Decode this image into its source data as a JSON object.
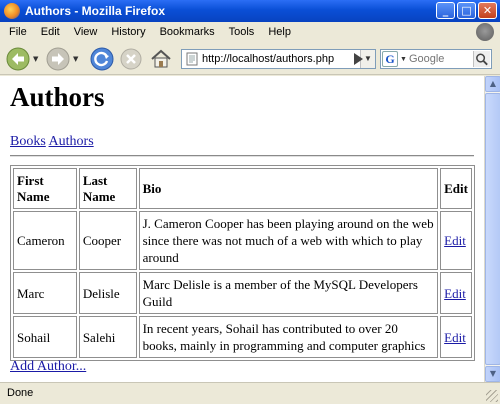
{
  "window": {
    "title": "Authors - Mozilla Firefox",
    "minimize_label": "_",
    "maximize_label": "□",
    "close_label": "✕"
  },
  "menu": [
    "File",
    "Edit",
    "View",
    "History",
    "Bookmarks",
    "Tools",
    "Help"
  ],
  "toolbar": {
    "url": "http://localhost/authors.php",
    "search_placeholder": "Google",
    "search_engine_letter": "G"
  },
  "page": {
    "heading": "Authors",
    "nav_links": [
      "Books",
      "Authors"
    ],
    "table": {
      "headers": [
        "First Name",
        "Last Name",
        "Bio",
        "Edit"
      ],
      "rows": [
        {
          "first": "Cameron",
          "last": "Cooper",
          "bio": "J. Cameron Cooper has been playing around on the web since there was not much of a web with which to play around",
          "edit": "Edit"
        },
        {
          "first": "Marc",
          "last": "Delisle",
          "bio": "Marc Delisle is a member of the MySQL Developers Guild",
          "edit": "Edit"
        },
        {
          "first": "Sohail",
          "last": "Salehi",
          "bio": "In recent years, Sohail has contributed to over 20 books, mainly in programming and computer graphics",
          "edit": "Edit"
        }
      ]
    },
    "add_link": "Add Author..."
  },
  "status": "Done",
  "colors": {
    "titlebar": "#0a4fd6",
    "chrome": "#ece9d8",
    "link": "#1a1aa6"
  }
}
